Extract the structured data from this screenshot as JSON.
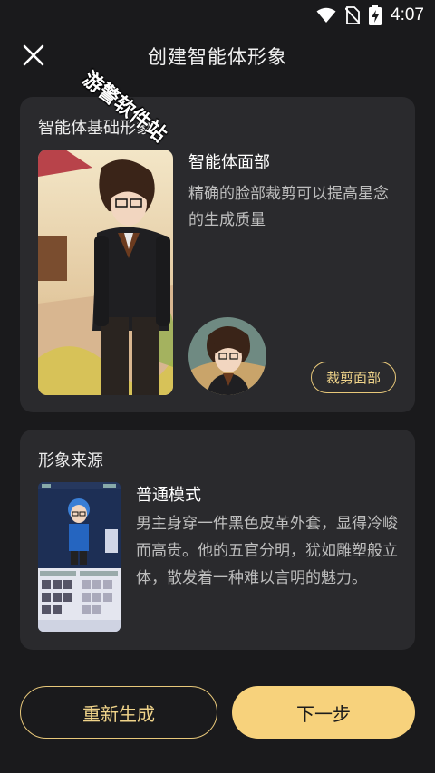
{
  "status_bar": {
    "time": "4:07",
    "icons": [
      "wifi-icon",
      "no-sim-icon",
      "battery-charging-icon"
    ]
  },
  "header": {
    "title": "创建智能体形象",
    "close_icon": "close-icon"
  },
  "watermark": "游警软件站",
  "base_section": {
    "title": "智能体基础形象",
    "face_title": "智能体面部",
    "face_desc": "精确的脸部裁剪可以提高星念的生成质量",
    "crop_button": "裁剪面部"
  },
  "source_section": {
    "title": "形象来源",
    "mode_title": "普通模式",
    "mode_desc": "男主身穿一件黑色皮革外套，显得冷峻而高贵。他的五官分明，犹如雕塑般立体，散发着一种难以言明的魅力。"
  },
  "actions": {
    "regenerate": "重新生成",
    "next": "下一步"
  },
  "colors": {
    "background": "#1a1a1c",
    "card": "#2a2a2d",
    "accent": "#f7d27c",
    "accent_border": "#e8c87a"
  }
}
